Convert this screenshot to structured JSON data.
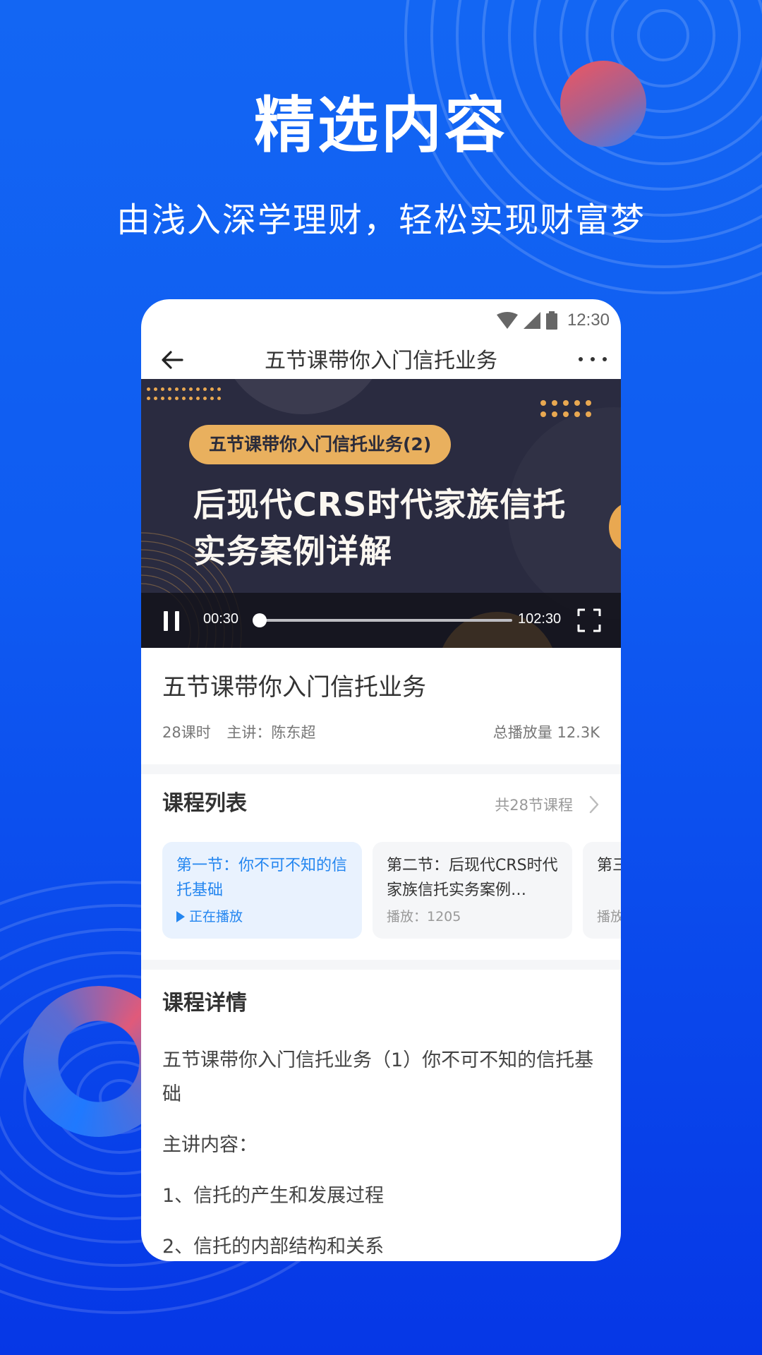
{
  "hero": {
    "title": "精选内容",
    "subtitle": "由浅入深学理财，轻松实现财富梦"
  },
  "status_bar": {
    "time": "12:30",
    "icons": [
      "wifi-icon",
      "signal-icon",
      "battery-icon"
    ]
  },
  "nav": {
    "title": "五节课带你入门信托业务",
    "back_icon": "arrow-left-icon",
    "more_icon": "more-horizontal-icon"
  },
  "video": {
    "tag": "五节课带你入门信托业务(2)",
    "headline": "后现代CRS时代家族信托实务案例详解",
    "current_time": "00:30",
    "total_time": "102:30",
    "progress_fraction": 0.005,
    "state": "playing"
  },
  "course": {
    "title": "五节课带你入门信托业务",
    "lessons_count": "28课时",
    "lecturer": "主讲：陈东超",
    "total_plays": "总播放量 12.3K"
  },
  "lesson_list": {
    "title": "课程列表",
    "count_label": "共28节课程",
    "items": [
      {
        "title": "第一节：你不可不知的信托基础",
        "status": "正在播放",
        "active": true
      },
      {
        "title": "第二节：后现代CRS时代家族信托实务案例…",
        "status": "播放：1205",
        "active": false
      },
      {
        "title": "第三节：…优势…",
        "status": "播放…",
        "active": false
      }
    ]
  },
  "details": {
    "title": "课程详情",
    "paragraphs": [
      "五节课带你入门信托业务（1）你不可不知的信托基础",
      "主讲内容：",
      "1、信托的产生和发展过程",
      "2、信托的内部结构和关系"
    ]
  },
  "colors": {
    "background": "#0f5cf2",
    "accent": "#2486f0",
    "video_tag": "#e9b05e",
    "video_bg": "#2a2b40"
  }
}
